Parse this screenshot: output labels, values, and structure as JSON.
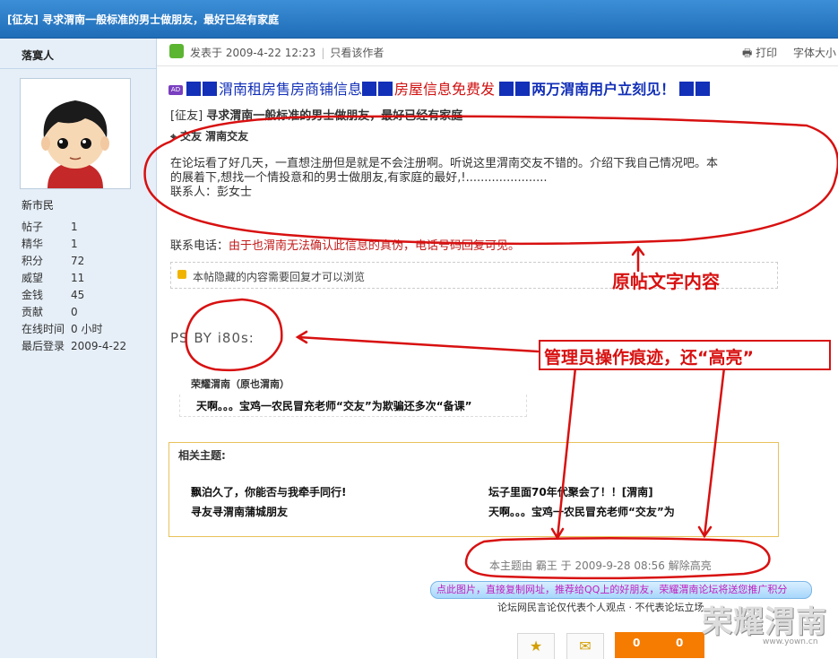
{
  "window": {
    "title": "[征友] 寻求渭南一般标准的男士做朋友，最好已经有家庭"
  },
  "sidebar": {
    "author": "落寞人",
    "usergroup": "新市民",
    "stats": [
      {
        "label": "帖子",
        "value": "1"
      },
      {
        "label": "精华",
        "value": "1"
      },
      {
        "label": "积分",
        "value": "72"
      },
      {
        "label": "威望",
        "value": "11"
      },
      {
        "label": "金钱",
        "value": "45"
      },
      {
        "label": "贡献",
        "value": "0"
      },
      {
        "label": "在线时间",
        "value": "0 小时"
      },
      {
        "label": "最后登录",
        "value": "2009-4-22"
      }
    ]
  },
  "post": {
    "posted_at": "发表于 2009-4-22 12:23",
    "author_only": "只看该作者",
    "print": "打印",
    "font_size": "字体大小",
    "ad": {
      "badge": "AD",
      "text1": "渭南租房售房商铺信息",
      "text2": "房屋信息免费发",
      "text3": "两万渭南用户立刻见！"
    },
    "subject_prefix": "[征友]",
    "subject": "寻求渭南一般标准的男士做朋友，最好已经有家庭",
    "tags": "交友  渭南交友",
    "body_line1": "在论坛看了好几天，一直想注册但是就是不会注册啊。听说这里渭南交友不错的。介绍下我自己情况吧。本",
    "body_line2": "的展着下,想找一个情投意和的男士做朋友,有家庭的最好,!......................",
    "body_line3": "联系人：彭女士",
    "contact_label": "联系电话：",
    "contact_value": "由于也渭南无法确认此信息的真伪，电话号码回复可见。",
    "hidden_notice": "本帖隐藏的内容需要回复才可以浏览",
    "ps": "PS BY i80s:",
    "signature_title": "荣耀渭南（原也渭南）",
    "signature_text": "天啊。。。宝鸡一农民冒充老师“交友”为欺骗还多次“备课”"
  },
  "related": {
    "heading": "相关主题:",
    "items": [
      "飘泊久了，你能否与我牵手同行!",
      "寻友寻渭南蒲城朋友",
      "坛子里面70年代聚会了！！[渭南]",
      "天啊。。。宝鸡一农民冒充老师“交友”为"
    ]
  },
  "moderation": "本主题由 霸王 于 2009-9-28 08:56 解除高亮",
  "promo": "点此图片，直接复制网址，推荐给QQ上的好朋友，荣耀渭南论坛将送您推广积分",
  "disclaimer": "论坛网民言论仅代表个人观点 · 不代表论坛立场",
  "rate_values": [
    "0",
    "0"
  ],
  "annotations": {
    "original": "原帖文字内容",
    "admin": "管理员操作痕迹，还“高亮”"
  },
  "watermark": {
    "text": "荣耀渭南",
    "url": "www.yown.cn"
  },
  "colors": {
    "annotation_red": "#d81010",
    "title_blue": "#1f6cb8"
  }
}
